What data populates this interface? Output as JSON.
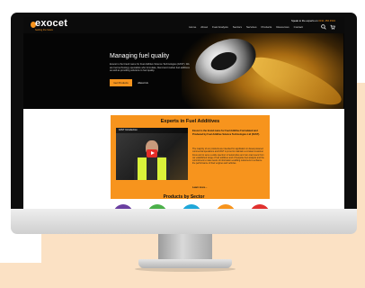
{
  "site": {
    "logo_text": "exocet",
    "tagline": "fuelling the future",
    "contact_label": "Speak to the experts on",
    "contact_phone": "0191 456 4543"
  },
  "nav": {
    "items": [
      "Home",
      "About",
      "Fuel Analysis",
      "Sectors",
      "Services",
      "Products",
      "Resources",
      "Contact"
    ]
  },
  "hero": {
    "title": "Managing fuel quality",
    "text": "Exocet is the brand name for Fuel Additive Science Technologies (FAST). We are fuel technology specialists who formulate, blend and market fuel additives as well as providing solutions to fuel quality.",
    "primary_button": "Get Products",
    "secondary_button": "About Us"
  },
  "experts": {
    "title": "Experts in Fuel Additives",
    "video_title": "FAST Introduction",
    "lead": "Exocet is the brand name for Fuel Additive Formulated and Produced by Fuel Additive Science Technologies Ltd (FAST).",
    "body": "The majority of our products are intended for application in diesel-powered commercial operations and FAST is proud to maintain a constant customer focus and to serve a wide spectrum of automotive and non-road users from our established range of fuel additives and of bespoke fuel analysis and the commitment to raise levels of information enabling customers to enhance the performance of their engines and vehicles.",
    "link": "Learn more..."
  },
  "sectors": {
    "title": "Products by Sector",
    "circles": [
      {
        "color": "#6a3fa0"
      },
      {
        "color": "#4bb04a"
      },
      {
        "color": "#1fa7d9"
      },
      {
        "color": "#f7941d"
      },
      {
        "color": "#e0312e"
      }
    ]
  },
  "colors": {
    "accent": "#f7941d",
    "backdrop": "#fbe1c4"
  }
}
